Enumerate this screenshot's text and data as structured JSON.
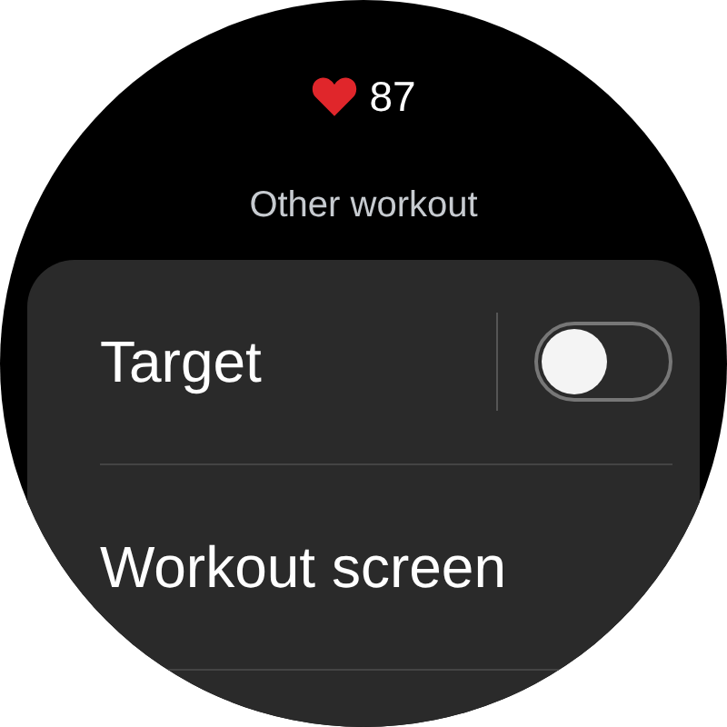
{
  "heart_rate": "87",
  "title": "Other workout",
  "settings": [
    {
      "kind": "toggle",
      "label": "Target",
      "on": false
    },
    {
      "kind": "link",
      "label": "Workout screen"
    }
  ]
}
